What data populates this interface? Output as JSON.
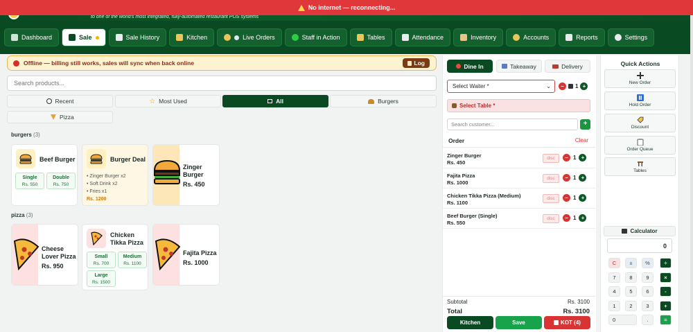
{
  "banner": {
    "offline_text": "No internet — reconnecting..."
  },
  "header": {
    "tagline": "to one of the world's most integrated, fully-automated restaurant POS systems"
  },
  "nav": [
    {
      "label": "Dashboard"
    },
    {
      "label": "Sale"
    },
    {
      "label": "Sale History"
    },
    {
      "label": "Kitchen"
    },
    {
      "label": "Live Orders"
    },
    {
      "label": "Staff in Action"
    },
    {
      "label": "Tables"
    },
    {
      "label": "Attendance"
    },
    {
      "label": "Inventory"
    },
    {
      "label": "Accounts"
    },
    {
      "label": "Reports"
    },
    {
      "label": "Settings"
    }
  ],
  "alert": {
    "text": "Offline — billing still works, sales will sync when back online",
    "log_label": "Log"
  },
  "search": {
    "placeholder": "Search products..."
  },
  "filters": [
    {
      "label": "Recent"
    },
    {
      "label": "Most Used"
    },
    {
      "label": "All"
    },
    {
      "label": "Burgers"
    },
    {
      "label": "Pizza"
    }
  ],
  "sections": {
    "burgers": {
      "title": "burgers",
      "count": "(3)"
    },
    "pizza": {
      "title": "pizza",
      "count": "(3)"
    }
  },
  "products": {
    "beef_burger": {
      "name": "Beef Burger",
      "variants": [
        {
          "name": "Single",
          "price": "Rs. 550"
        },
        {
          "name": "Double",
          "price": "Rs. 750"
        }
      ]
    },
    "burger_deal": {
      "name": "Burger Deal",
      "items": [
        "• Zinger Burger x2",
        "• Soft Drink x2",
        "• Fries x1"
      ],
      "price": "Rs. 1200"
    },
    "zinger_burger": {
      "name_line1": "Zinger",
      "name_line2": "Burger",
      "price": "Rs. 450"
    },
    "cheese_lover": {
      "name_line1": "Cheese",
      "name_line2": "Lover Pizza",
      "price": "Rs. 950"
    },
    "chicken_tikka": {
      "name_line1": "Chicken",
      "name_line2": "Tikka Pizza",
      "variants": [
        {
          "name": "Small",
          "price": "Rs. 700"
        },
        {
          "name": "Medium",
          "price": "Rs. 1100"
        },
        {
          "name": "Large",
          "price": "Rs. 1500"
        }
      ]
    },
    "fajita": {
      "name": "Fajita Pizza",
      "price": "Rs. 1000"
    }
  },
  "order": {
    "tabs": [
      {
        "label": "Dine In"
      },
      {
        "label": "Takeaway"
      },
      {
        "label": "Delivery"
      }
    ],
    "waiter_placeholder": "Select Waiter *",
    "guests": "1",
    "table_label": "Select Table *",
    "customer_placeholder": "Search customer...",
    "header": "Order",
    "clear_label": "Clear",
    "discount_placeholder": "disc",
    "items": [
      {
        "name": "Zinger Burger",
        "price": "Rs. 450",
        "qty": "1"
      },
      {
        "name": "Fajita Pizza",
        "price": "Rs. 1000",
        "qty": "1"
      },
      {
        "name": "Chicken Tikka Pizza (Medium)",
        "price": "Rs. 1100",
        "qty": "1"
      },
      {
        "name": "Beef Burger (Single)",
        "price": "Rs. 550",
        "qty": "1"
      }
    ],
    "subtotal_label": "Subtotal",
    "subtotal": "Rs. 3100",
    "total_label": "Total",
    "total": "Rs. 3100",
    "actions": {
      "kitchen": "Kitchen",
      "save": "Save",
      "kot": "KOT (4)"
    }
  },
  "quick_actions": {
    "title": "Quick Actions",
    "items": [
      {
        "label": "New Order"
      },
      {
        "label": "Hold Order"
      },
      {
        "label": "Discount"
      },
      {
        "label": "Order Queue"
      },
      {
        "label": "Tables"
      }
    ]
  },
  "calculator": {
    "title": "Calculator",
    "display": "0",
    "keys": [
      [
        "C",
        "±",
        "%",
        "÷"
      ],
      [
        "7",
        "8",
        "9",
        "×"
      ],
      [
        "4",
        "5",
        "6",
        "-"
      ],
      [
        "1",
        "2",
        "3",
        "+"
      ],
      [
        "0",
        ".",
        "="
      ]
    ]
  },
  "colors": {
    "brand_green": "#0a4a22",
    "offline_red": "#e0383a",
    "accent_red": "#d93434",
    "save_green": "#16a34a"
  }
}
